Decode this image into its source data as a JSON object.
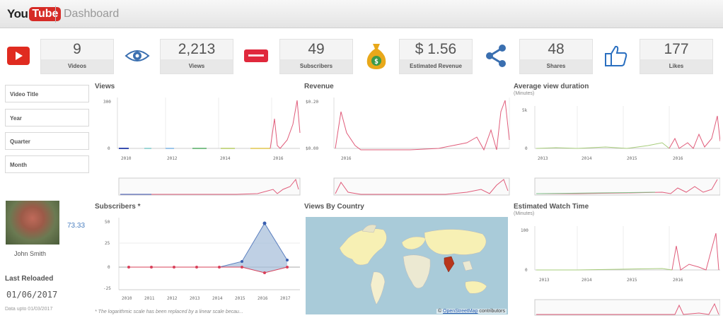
{
  "header": {
    "logo_you": "You",
    "logo_tube": "Tube",
    "title": "Dashboard"
  },
  "kpis": [
    {
      "value": "9",
      "label": "Videos",
      "icon": "youtube-play-icon",
      "color": "#e02b20"
    },
    {
      "value": "2,213",
      "label": "Views",
      "icon": "eye-icon",
      "color": "#3a6fb0"
    },
    {
      "value": "49",
      "label": "Subscribers",
      "icon": "subscribe-icon",
      "color": "#e0283c"
    },
    {
      "value": "$ 1.56",
      "label": "Estimated Revenue",
      "icon": "money-bag-icon",
      "color": "#e8a81a"
    },
    {
      "value": "48",
      "label": "Shares",
      "icon": "share-icon",
      "color": "#3a6fb0"
    },
    {
      "value": "177",
      "label": "Likes",
      "icon": "thumbs-up-icon",
      "color": "#2a6fc0"
    }
  ],
  "filters": [
    "Video Title",
    "Year",
    "Quarter",
    "Month"
  ],
  "profile": {
    "score": "73.33",
    "name": "John Smith"
  },
  "reload": {
    "label": "Last Reloaded",
    "date": "01/06/2017",
    "data_upto": "Data upto 01/03/2017"
  },
  "panels": {
    "views": {
      "title": "Views",
      "y_ticks": [
        "300",
        "0"
      ],
      "x_ticks": [
        "2010",
        "2012",
        "2014",
        "2016"
      ]
    },
    "revenue": {
      "title": "Revenue",
      "y_ticks": [
        "$0.20",
        "$0.00"
      ],
      "x_ticks": [
        "2016"
      ]
    },
    "avg_view": {
      "title": "Average view duration",
      "subtitle": "(Minutes)",
      "y_ticks": [
        "5k",
        "0"
      ],
      "x_ticks": [
        "2013",
        "2014",
        "2015",
        "2016"
      ]
    },
    "subscribers": {
      "title": "Subscribers *",
      "y_ticks": [
        "50",
        "25",
        "0",
        "-25"
      ],
      "x_ticks": [
        "2010",
        "2011",
        "2012",
        "2013",
        "2014",
        "2015",
        "2016",
        "2017"
      ]
    },
    "country": {
      "title": "Views By Country",
      "attribution_prefix": "© ",
      "attribution_link": "OpenStreetMap",
      "attribution_suffix": " contributors"
    },
    "watch_time": {
      "title": "Estimated Watch Time",
      "subtitle": "(Minutes)",
      "y_ticks": [
        "100",
        "0"
      ],
      "x_ticks": [
        "2013",
        "2014",
        "2015",
        "2016"
      ]
    }
  },
  "footnote": "* The logarithmic scale has been replaced by a linear scale becau...",
  "chart_data": [
    {
      "type": "line",
      "title": "Views",
      "x": [
        2010,
        2011,
        2012,
        2013,
        2014,
        2015,
        2016,
        2016.3,
        2016.6,
        2016.9
      ],
      "series": [
        {
          "values": [
            5,
            0,
            2,
            4,
            3,
            8,
            6,
            160,
            20,
            300
          ]
        }
      ],
      "ylim": [
        0,
        300
      ]
    },
    {
      "type": "line",
      "title": "Revenue",
      "x": [
        2016.0,
        2016.1,
        2016.2,
        2016.4,
        2016.6,
        2016.8,
        2016.9,
        2017.0,
        2017.1
      ],
      "series": [
        {
          "values": [
            0.15,
            0.01,
            0.0,
            0.01,
            0.03,
            0.0,
            0.1,
            0.02,
            0.2
          ]
        }
      ],
      "ylim": [
        0,
        0.2
      ]
    },
    {
      "type": "line",
      "title": "Average view duration",
      "ylabel": "(Minutes)",
      "x": [
        2013,
        2014,
        2015,
        2016,
        2016.3,
        2016.6,
        2016.9
      ],
      "series": [
        {
          "values": [
            100,
            50,
            200,
            300,
            2100,
            1500,
            5000
          ]
        }
      ],
      "ylim": [
        0,
        5000
      ]
    },
    {
      "type": "area",
      "title": "Subscribers *",
      "x": [
        2010,
        2011,
        2012,
        2013,
        2014,
        2015,
        2016,
        2017
      ],
      "series": [
        {
          "values": [
            0,
            0,
            0,
            0,
            0,
            6,
            50,
            7
          ]
        },
        {
          "values": [
            0,
            0,
            0,
            0,
            0,
            0,
            -7,
            0
          ]
        }
      ],
      "ylim": [
        -25,
        50
      ]
    },
    {
      "type": "line",
      "title": "Estimated Watch Time",
      "ylabel": "(Minutes)",
      "x": [
        2013,
        2014,
        2015,
        2016,
        2016.3,
        2016.6,
        2016.9
      ],
      "series": [
        {
          "values": [
            2,
            1,
            3,
            5,
            60,
            5,
            80
          ]
        }
      ],
      "ylim": [
        0,
        100
      ]
    }
  ]
}
